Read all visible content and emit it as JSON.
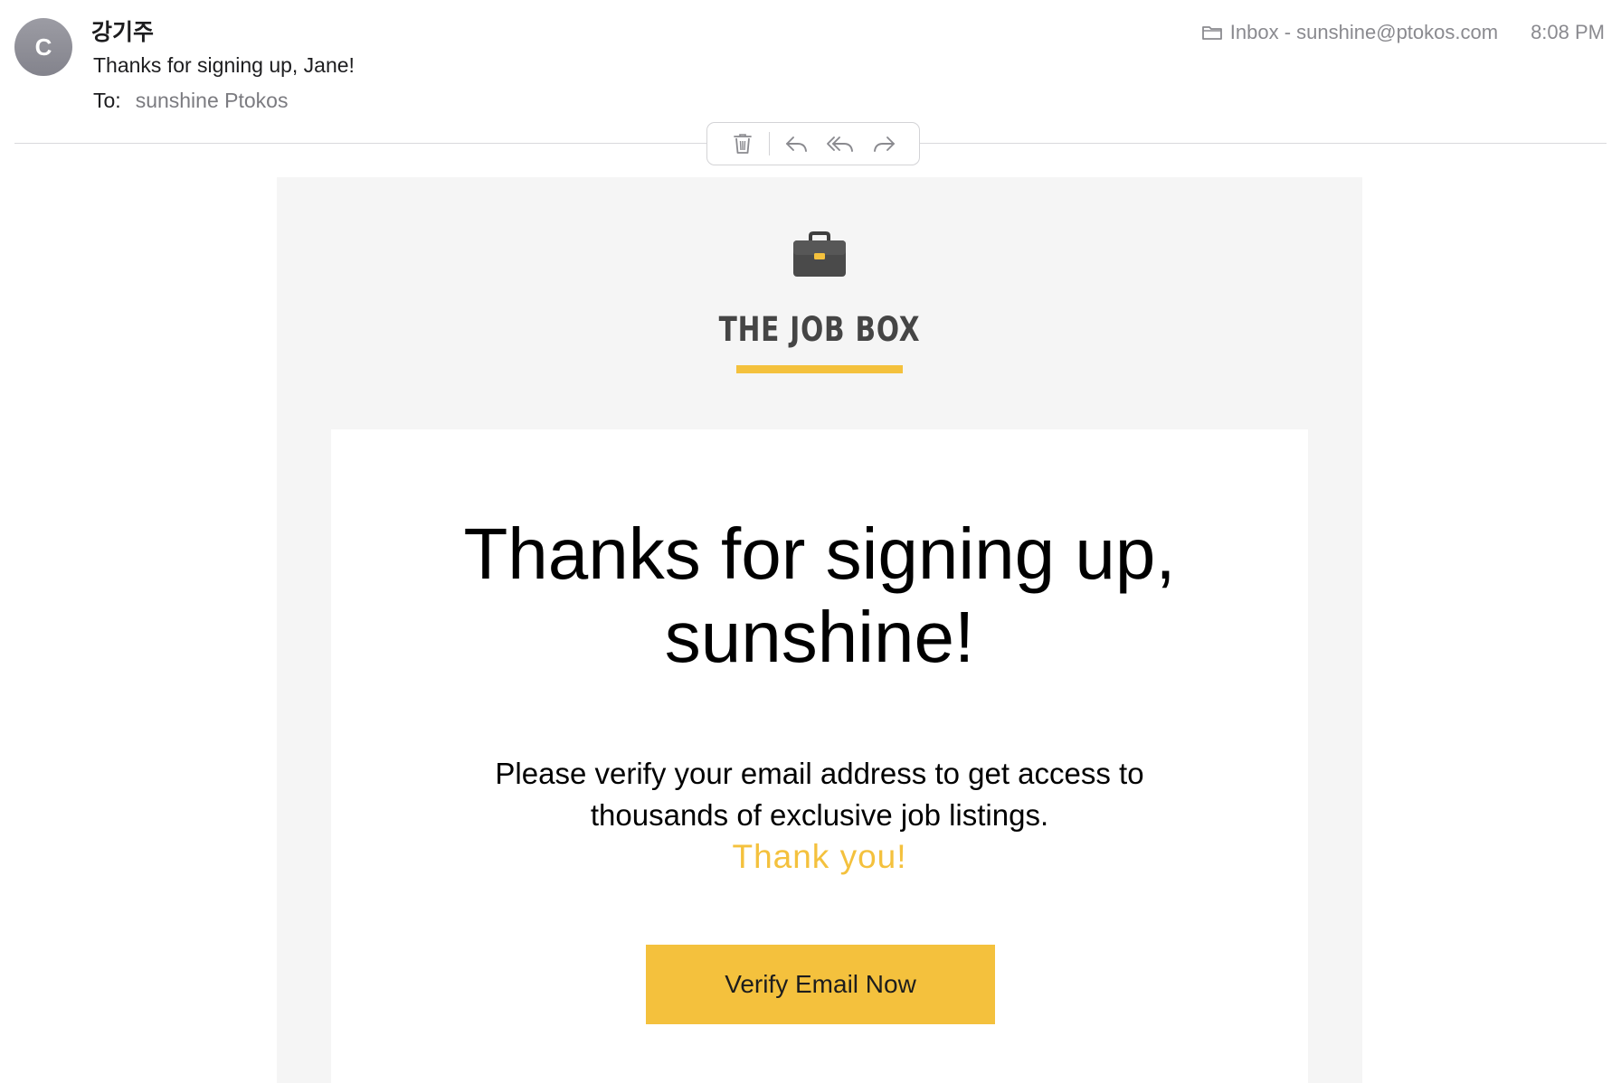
{
  "header": {
    "avatar_initial": "C",
    "sender": "강기주",
    "subject": "Thanks for signing up, Jane!",
    "to_label": "To:",
    "to_value": "sunshine Ptokos",
    "mailbox": "Inbox - sunshine@ptokos.com",
    "time": "8:08 PM"
  },
  "toolbar": {
    "icons": [
      "trash-icon",
      "reply-icon",
      "reply-all-icon",
      "forward-icon"
    ]
  },
  "email": {
    "logo_text": "THE JOB BOX",
    "headline_line1": "Thanks for signing up,",
    "headline_line2": "sunshine!",
    "body_line1": "Please verify your email address to get access to",
    "body_line2": "thousands of exclusive job listings.",
    "thanks": "Thank you!",
    "button_label": "Verify Email Now"
  },
  "colors": {
    "accent": "#f4c13d",
    "email_background": "#f5f5f5",
    "card_background": "#ffffff",
    "muted_text": "#8a8a8f"
  }
}
